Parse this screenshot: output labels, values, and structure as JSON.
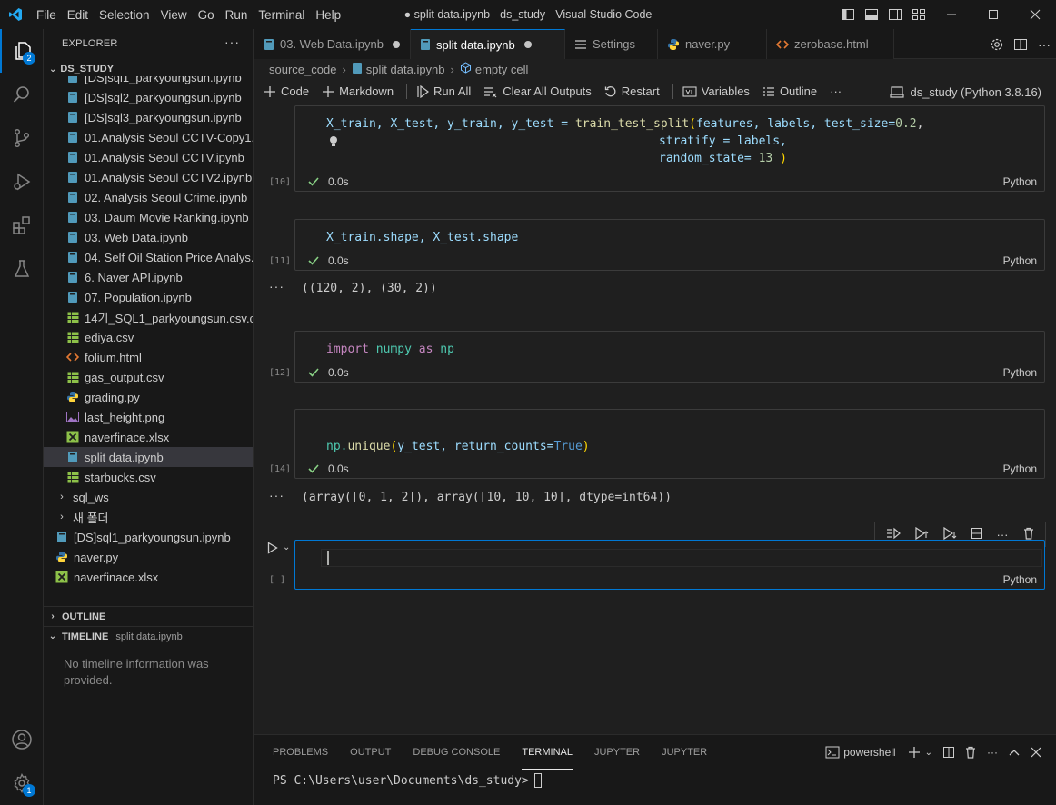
{
  "window": {
    "title": "● split data.ipynb - ds_study - Visual Studio Code",
    "menu": [
      "File",
      "Edit",
      "Selection",
      "View",
      "Go",
      "Run",
      "Terminal",
      "Help"
    ]
  },
  "activity": {
    "explorer_badge": "2",
    "settings_badge": "1"
  },
  "explorer": {
    "header": "EXPLORER",
    "workspace": "DS_STUDY",
    "items": [
      {
        "label": "[DS]sql1_parkyoungsun.ipynb",
        "icon": "notebook-icon",
        "indent": 1
      },
      {
        "label": "[DS]sql2_parkyoungsun.ipynb",
        "icon": "notebook-icon",
        "indent": 1
      },
      {
        "label": "[DS]sql3_parkyoungsun.ipynb",
        "icon": "notebook-icon",
        "indent": 1
      },
      {
        "label": "01.Analysis Seoul CCTV-Copy1....",
        "icon": "notebook-icon",
        "indent": 1
      },
      {
        "label": "01.Analysis Seoul CCTV.ipynb",
        "icon": "notebook-icon",
        "indent": 1
      },
      {
        "label": "01.Analysis Seoul CCTV2.ipynb",
        "icon": "notebook-icon",
        "indent": 1
      },
      {
        "label": "02. Analysis Seoul Crime.ipynb",
        "icon": "notebook-icon",
        "indent": 1
      },
      {
        "label": "03. Daum Movie Ranking.ipynb",
        "icon": "notebook-icon",
        "indent": 1
      },
      {
        "label": "03. Web Data.ipynb",
        "icon": "notebook-icon",
        "indent": 1
      },
      {
        "label": "04. Self Oil Station Price Analys...",
        "icon": "notebook-icon",
        "indent": 1
      },
      {
        "label": "6. Naver API.ipynb",
        "icon": "notebook-icon",
        "indent": 1
      },
      {
        "label": "07. Population.ipynb",
        "icon": "notebook-icon",
        "indent": 1
      },
      {
        "label": "14기_SQL1_parkyoungsun.csv.c...",
        "icon": "csv-icon",
        "indent": 1
      },
      {
        "label": "ediya.csv",
        "icon": "csv-icon",
        "indent": 1
      },
      {
        "label": "folium.html",
        "icon": "html-icon",
        "indent": 1
      },
      {
        "label": "gas_output.csv",
        "icon": "csv-icon",
        "indent": 1
      },
      {
        "label": "grading.py",
        "icon": "python-icon",
        "indent": 1
      },
      {
        "label": "last_height.png",
        "icon": "image-icon",
        "indent": 1
      },
      {
        "label": "naverfinace.xlsx",
        "icon": "excel-icon",
        "indent": 1
      },
      {
        "label": "split data.ipynb",
        "icon": "notebook-icon",
        "indent": 1,
        "selected": true
      },
      {
        "label": "starbucks.csv",
        "icon": "csv-icon",
        "indent": 1
      },
      {
        "label": "sql_ws",
        "icon": "folder",
        "indent": 0
      },
      {
        "label": "새 폴더",
        "icon": "folder",
        "indent": 0
      },
      {
        "label": "[DS]sql1_parkyoungsun.ipynb",
        "icon": "notebook-icon",
        "indent": 0
      },
      {
        "label": "naver.py",
        "icon": "python-icon",
        "indent": 0
      },
      {
        "label": "naverfinace.xlsx",
        "icon": "excel-icon",
        "indent": 0
      }
    ],
    "outline": "OUTLINE",
    "timeline": "TIMELINE",
    "timeline_file": "split data.ipynb",
    "timeline_msg": "No timeline information was provided."
  },
  "tabs": [
    {
      "label": "03. Web Data.ipynb",
      "icon": "notebook-icon",
      "dirty": true
    },
    {
      "label": "split data.ipynb",
      "icon": "notebook-icon",
      "dirty": true,
      "active": true
    },
    {
      "label": "Settings",
      "icon": "settings-list-icon"
    },
    {
      "label": "naver.py",
      "icon": "python-icon"
    },
    {
      "label": "zerobase.html",
      "icon": "html-icon"
    }
  ],
  "breadcrumb": [
    "source_code",
    "split data.ipynb",
    "empty cell"
  ],
  "toolbar": {
    "code": "Code",
    "markdown": "Markdown",
    "run_all": "Run All",
    "clear": "Clear All Outputs",
    "restart": "Restart",
    "variables": "Variables",
    "outline": "Outline",
    "more": "···",
    "kernel": "ds_study (Python 3.8.16)"
  },
  "cells": [
    {
      "exec": "[10]",
      "time": "0.0s",
      "lang": "Python"
    },
    {
      "exec": "[11]",
      "time": "0.0s",
      "lang": "Python",
      "output": "((120, 2), (30, 2))"
    },
    {
      "exec": "[12]",
      "time": "0.0s",
      "lang": "Python"
    },
    {
      "exec": "[14]",
      "time": "0.0s",
      "lang": "Python",
      "output": "(array([0, 1, 2]), array([10, 10, 10], dtype=int64))"
    },
    {
      "exec": "[ ]",
      "lang": "Python"
    }
  ],
  "code": {
    "c10_l1_a": "X_train, X_test, y_train, y_test = ",
    "c10_fn": "train_test_split",
    "c10_l1_b": "features, labels, test_size=",
    "c10_num1": "0.2",
    "c10_l2": "stratify = labels,",
    "c10_l3": "random_state= ",
    "c10_num2": "13",
    "c11": "X_train.shape, X_test.shape",
    "c12_import": "import",
    "c12_mod": "numpy",
    "c12_as": "as",
    "c12_alias": "np",
    "c14_np": "np.",
    "c14_fn": "unique",
    "c14_args": "y_test, return_counts=",
    "c14_true": "True"
  },
  "panel": {
    "tabs": [
      "PROBLEMS",
      "OUTPUT",
      "DEBUG CONSOLE",
      "TERMINAL",
      "JUPYTER",
      "JUPYTER"
    ],
    "active": "TERMINAL",
    "shell": "powershell",
    "prompt": "PS C:\\Users\\user\\Documents\\ds_study>"
  }
}
